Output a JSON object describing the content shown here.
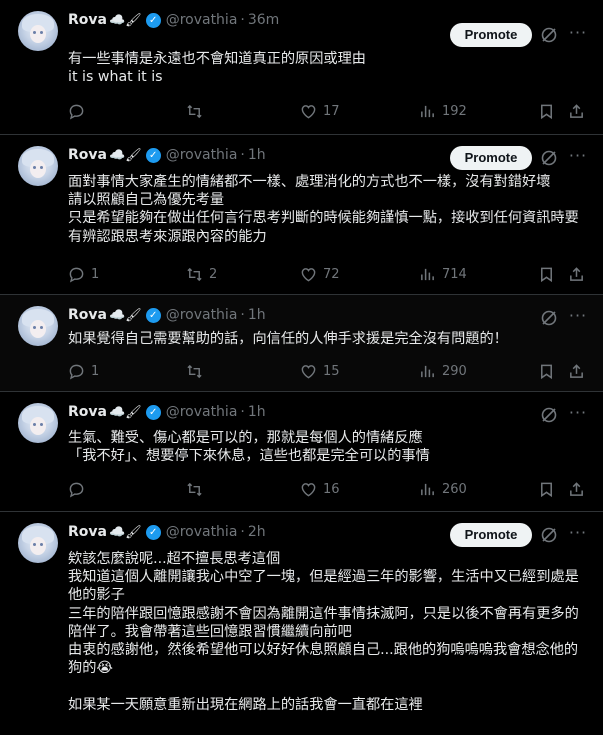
{
  "tweets": [
    {
      "name": "Rova",
      "name_emoji": "☁️🖌",
      "handle": "@rovathia",
      "time": "36m",
      "promote_label": "Promote",
      "text": "有一些事情是永遠也不會知道真正的原因或理由\nit is what it is",
      "replies": "",
      "reposts": "",
      "likes": "17",
      "views": "192"
    },
    {
      "name": "Rova",
      "name_emoji": "☁️🖌",
      "handle": "@rovathia",
      "time": "1h",
      "promote_label": "Promote",
      "text": "面對事情大家產生的情緒都不一樣、處理消化的方式也不一樣，沒有對錯好壞\n請以照顧自己為優先考量\n只是希望能夠在做出任何言行思考判斷的時候能夠謹慎一點，接收到任何資訊時要有辨認跟思考來源跟內容的能力",
      "replies": "1",
      "reposts": "2",
      "likes": "72",
      "views": "714"
    },
    {
      "name": "Rova",
      "name_emoji": "☁️🖌",
      "handle": "@rovathia",
      "time": "1h",
      "promote_label": "",
      "text": "如果覺得自己需要幫助的話，向信任的人伸手求援是完全沒有問題的！",
      "replies": "1",
      "reposts": "",
      "likes": "15",
      "views": "290"
    },
    {
      "name": "Rova",
      "name_emoji": "☁️🖌",
      "handle": "@rovathia",
      "time": "1h",
      "promote_label": "",
      "text": "生氣、難受、傷心都是可以的，那就是每個人的情緒反應\n「我不好」、想要停下來休息，這些也都是完全可以的事情",
      "replies": "",
      "reposts": "",
      "likes": "16",
      "views": "260"
    },
    {
      "name": "Rova",
      "name_emoji": "☁️🖌",
      "handle": "@rovathia",
      "time": "2h",
      "promote_label": "Promote",
      "text": "欸該怎麼說呢...超不擅長思考這個\n我知道這個人離開讓我心中空了一塊，但是經過三年的影響，生活中又已經到處是他的影子\n三年的陪伴跟回憶跟感謝不會因為離開這件事情抹滅阿，只是以後不會再有更多的陪伴了。我會帶著這些回憶跟習慣繼續向前吧\n由衷的感謝他，然後希望他可以好好休息照顧自己...跟他的狗嗚嗚嗚我會想念他的狗的😭\n\n如果某一天願意重新出現在網路上的話我會一直都在這裡",
      "replies": "",
      "reposts": "",
      "likes": "",
      "views": ""
    }
  ]
}
